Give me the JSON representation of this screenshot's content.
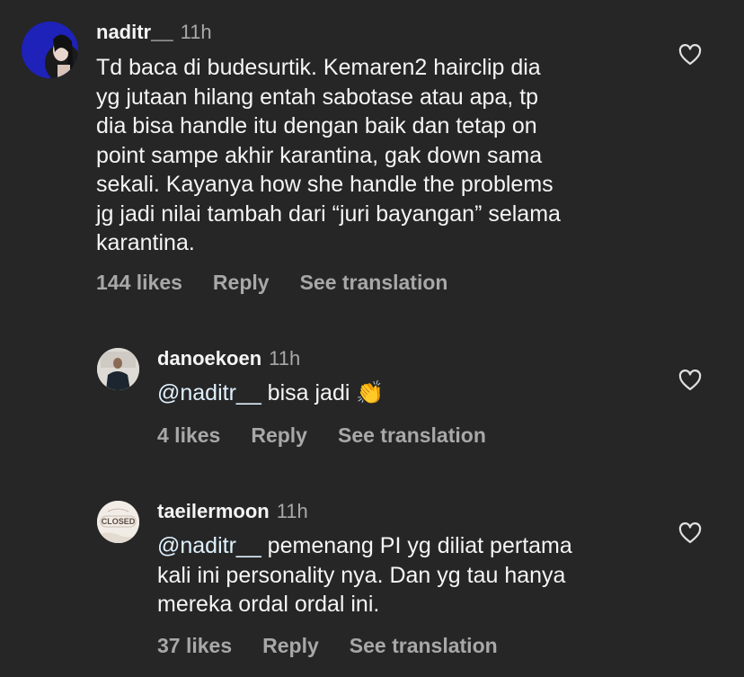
{
  "comments": [
    {
      "username": "naditr__",
      "time": "11h",
      "lines": [
        "Td baca di budesurtik. Kemaren2 hairclip dia",
        "yg jutaan hilang entah sabotase atau apa, tp",
        "dia bisa handle itu dengan baik dan tetap on",
        "point sampe akhir karantina, gak down sama",
        "sekali. Kayanya how she handle the problems",
        "jg jadi nilai tambah dari “juri bayangan” selama",
        "karantina."
      ],
      "likes": "144 likes",
      "reply_label": "Reply",
      "translate_label": "See translation",
      "avatar_icon": "user-avatar-icon",
      "like_icon": "heart-outline-icon"
    },
    {
      "username": "danoekoen",
      "time": "11h",
      "mention": "@naditr__",
      "text": " bisa jadi ",
      "emoji": "👏",
      "likes": "4 likes",
      "reply_label": "Reply",
      "translate_label": "See translation",
      "avatar_icon": "user-avatar-icon",
      "like_icon": "heart-outline-icon"
    },
    {
      "username": "taeilermoon",
      "time": "11h",
      "mention": "@naditr__",
      "line1_rest": " pemenang PI yg diliat pertama",
      "line2": "kali ini personality nya. Dan yg tau hanya",
      "line3": "mereka ordal ordal ini.",
      "avatar_text": "CLOSED",
      "likes": "37 likes",
      "reply_label": "Reply",
      "translate_label": "See translation",
      "avatar_icon": "closed-sign-avatar-icon",
      "like_icon": "heart-outline-icon"
    }
  ],
  "colors": {
    "background": "#262626",
    "primary_text": "#f5f5f5",
    "secondary_text": "#a8a8a8",
    "mention": "#e0f1ff"
  }
}
